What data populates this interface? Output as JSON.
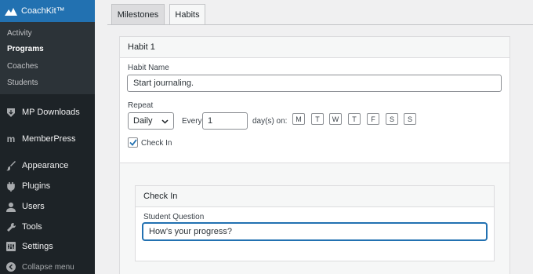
{
  "sidebar": {
    "brand": "CoachKit™",
    "submenu": [
      "Activity",
      "Programs",
      "Coaches",
      "Students"
    ],
    "active_submenu": "Programs",
    "items": [
      {
        "label": "MP Downloads",
        "icon": "download-icon"
      },
      {
        "label": "MemberPress",
        "icon": "memberpress-icon"
      },
      {
        "label": "Appearance",
        "icon": "paintbrush-icon"
      },
      {
        "label": "Plugins",
        "icon": "plug-icon"
      },
      {
        "label": "Users",
        "icon": "user-icon"
      },
      {
        "label": "Tools",
        "icon": "wrench-icon"
      },
      {
        "label": "Settings",
        "icon": "settings-icon"
      }
    ],
    "collapse": "Collapse menu"
  },
  "tabs": [
    {
      "label": "Milestones",
      "active": false
    },
    {
      "label": "Habits",
      "active": true
    }
  ],
  "habit": {
    "title": "Habit 1",
    "name_label": "Habit Name",
    "name_value": "Start journaling.",
    "repeat_label": "Repeat",
    "repeat_value": "Daily",
    "every_label": "Every",
    "every_value": "1",
    "days_label": "day(s) on:",
    "days": [
      "M",
      "T",
      "W",
      "T",
      "F",
      "S",
      "S"
    ],
    "checkin_label": "Check In",
    "checkin_checked": true
  },
  "checkin": {
    "title": "Check In",
    "question_label": "Student Question",
    "question_value": "How's your progress?"
  },
  "colors": {
    "sidebar_bg": "#1d2327",
    "accent": "#2271b1"
  }
}
